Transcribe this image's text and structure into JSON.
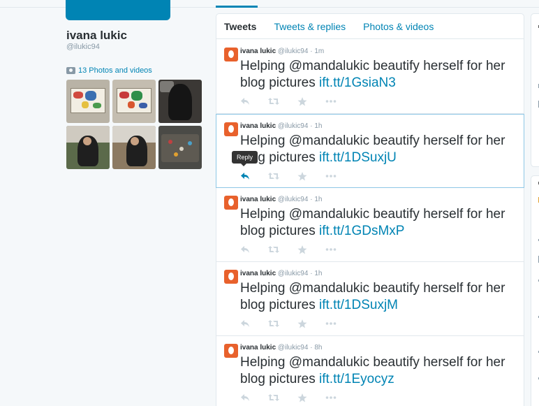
{
  "profile": {
    "name": "ivana lukic",
    "handle": "@ilukic94",
    "photos_label": "13 Photos and videos"
  },
  "tabs": [
    {
      "label": "Tweets",
      "active": true
    },
    {
      "label": "Tweets & replies",
      "active": false
    },
    {
      "label": "Photos & videos",
      "active": false
    }
  ],
  "tweets": [
    {
      "name": "ivana lukic",
      "handle": "@ilukic94",
      "sep": "·",
      "time": "1m",
      "text": "Helping @mandalukic beautify herself for her blog pictures ",
      "link": "ift.tt/1GsiaN3"
    },
    {
      "name": "ivana lukic",
      "handle": "@ilukic94",
      "sep": "·",
      "time": "1h",
      "text": "Helping @mandalukic beautify herself for her blog pictures ",
      "link": "ift.tt/1DSuxjU"
    },
    {
      "name": "ivana lukic",
      "handle": "@ilukic94",
      "sep": "·",
      "time": "1h",
      "text": "Helping @mandalukic beautify herself for her blog pictures ",
      "link": "ift.tt/1GDsMxP"
    },
    {
      "name": "ivana lukic",
      "handle": "@ilukic94",
      "sep": "·",
      "time": "1h",
      "text": "Helping @mandalukic beautify herself for her blog pictures ",
      "link": "ift.tt/1DSuxjM"
    },
    {
      "name": "ivana lukic",
      "handle": "@ilukic94",
      "sep": "·",
      "time": "8h",
      "text": "Helping @mandalukic beautify herself for her blog pictures ",
      "link": "ift.tt/1Eyocyz"
    }
  ],
  "tooltip": "Reply",
  "colors": {
    "accent": "#0084b4",
    "avatar": "#e8612c",
    "hover_border": "#8ec7e6"
  },
  "icons": [
    "camera-icon",
    "reply-icon",
    "retweet-icon",
    "favorite-icon",
    "more-icon"
  ]
}
